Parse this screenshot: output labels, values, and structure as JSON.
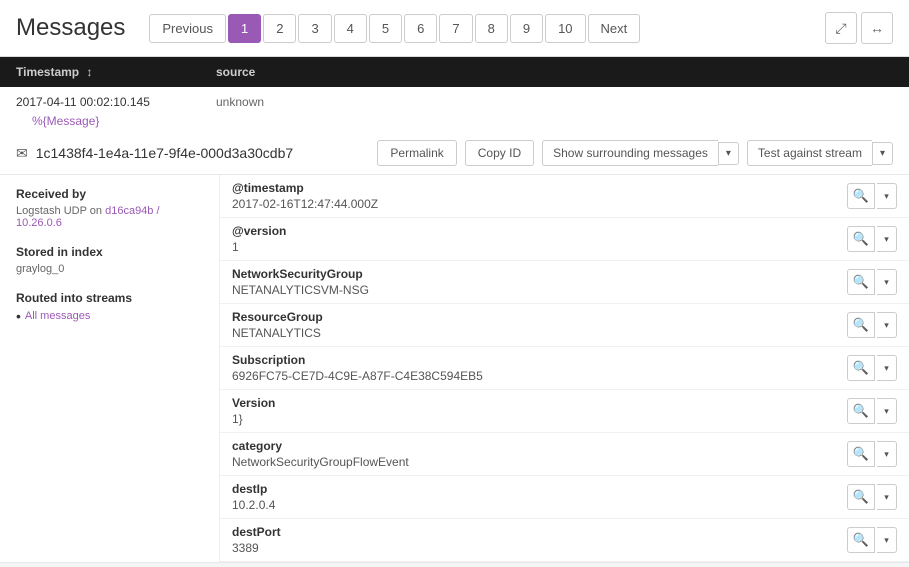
{
  "page": {
    "title": "Messages"
  },
  "pagination": {
    "previous_label": "Previous",
    "next_label": "Next",
    "current_page": 1,
    "pages": [
      "1",
      "2",
      "3",
      "4",
      "5",
      "6",
      "7",
      "8",
      "9",
      "10"
    ]
  },
  "table_header": {
    "col1": "Timestamp",
    "col2": "source"
  },
  "message": {
    "timestamp": "2017-04-11 00:02:10.145",
    "source": "unknown",
    "link": "%{Message}",
    "id": "1c1438f4-1e4a-11e7-9f4e-000d3a30cdb7",
    "actions": {
      "permalink": "Permalink",
      "copy_id": "Copy ID",
      "show_surrounding": "Show surrounding messages",
      "test_against_stream": "Test against stream"
    },
    "received_by_label": "Received by",
    "received_by_value": "Logstash UDP on",
    "received_by_link": "d16ca94b / 10.26.0.6",
    "stored_label": "Stored in index",
    "stored_value": "graylog_0",
    "streams_label": "Routed into streams",
    "streams_link": "All messages"
  },
  "fields": [
    {
      "name": "@timestamp",
      "value": "2017-02-16T12:47:44.000Z"
    },
    {
      "name": "@version",
      "value": "1"
    },
    {
      "name": "NetworkSecurityGroup",
      "value": "NETANALYTICSVM-NSG"
    },
    {
      "name": "ResourceGroup",
      "value": "NETANALYTICS"
    },
    {
      "name": "Subscription",
      "value": "6926FC75-CE7D-4C9E-A87F-C4E38C594EB5"
    },
    {
      "name": "Version",
      "value": "1}"
    },
    {
      "name": "category",
      "value": "NetworkSecurityGroupFlowEvent"
    },
    {
      "name": "destIp",
      "value": "10.2.0.4"
    },
    {
      "name": "destPort",
      "value": "3389"
    }
  ],
  "icons": {
    "envelope": "✉",
    "search": "🔍",
    "caret_down": "▾",
    "expand": "⤢",
    "compress": "⤡",
    "sort": "↕",
    "bullet": "•"
  }
}
